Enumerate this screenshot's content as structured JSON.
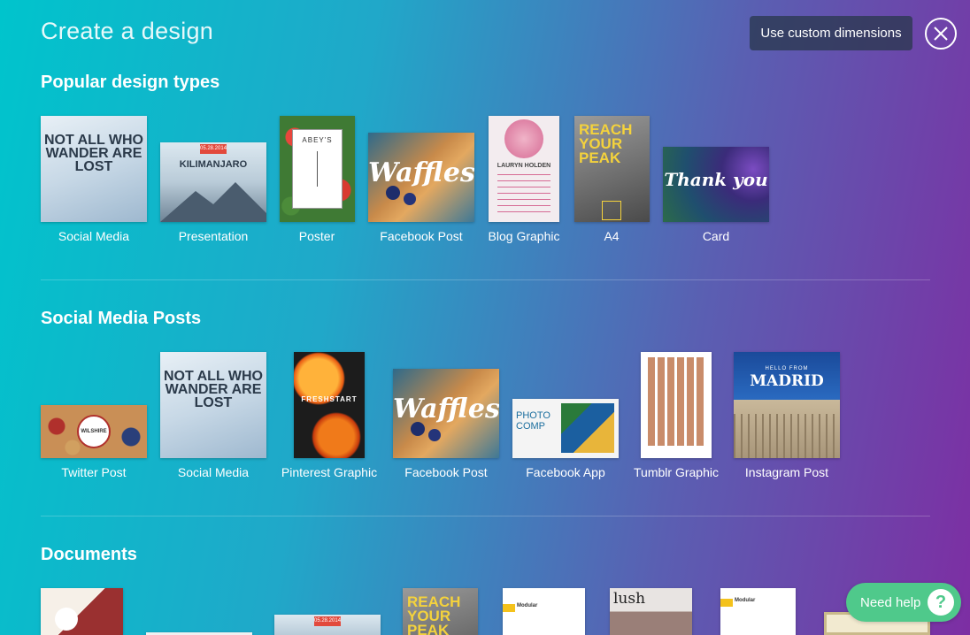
{
  "header": {
    "title": "Create a design",
    "custom_dimensions_label": "Use custom dimensions",
    "close_icon": "close-circle-icon"
  },
  "sections": [
    {
      "title": "Popular design types",
      "items": [
        {
          "label": "Social Media",
          "art": "NOT ALL WHO WANDER ARE LOST"
        },
        {
          "label": "Presentation",
          "art": "KILIMANJARO",
          "badge": "05.28.2014"
        },
        {
          "label": "Poster",
          "art": "ABEY'S"
        },
        {
          "label": "Facebook Post",
          "art": "Waffles"
        },
        {
          "label": "Blog Graphic",
          "art": "LAURYN HOLDEN"
        },
        {
          "label": "A4",
          "art": "REACH YOUR PEAK"
        },
        {
          "label": "Card",
          "art": "Thank you"
        }
      ]
    },
    {
      "title": "Social Media Posts",
      "items": [
        {
          "label": "Twitter Post",
          "art": "WILSHIRE"
        },
        {
          "label": "Social Media",
          "art": "NOT ALL WHO WANDER ARE LOST"
        },
        {
          "label": "Pinterest Graphic",
          "art": "FRESHSTART"
        },
        {
          "label": "Facebook Post",
          "art": "Waffles"
        },
        {
          "label": "Facebook App",
          "art": "PHOTO COMP"
        },
        {
          "label": "Tumblr Graphic",
          "art": ""
        },
        {
          "label": "Instagram Post",
          "art": "MADRID",
          "subart": "HELLO FROM"
        }
      ]
    },
    {
      "title": "Documents",
      "items": [
        {
          "label": "",
          "art": ""
        },
        {
          "label": "",
          "art": ""
        },
        {
          "label": "",
          "art": "",
          "badge": "05.28.2014"
        },
        {
          "label": "",
          "art": "REACH YOUR PEAK"
        },
        {
          "label": "",
          "art": "Modular"
        },
        {
          "label": "",
          "art": "lush"
        },
        {
          "label": "",
          "art": "Modular"
        },
        {
          "label": "",
          "art": ""
        }
      ]
    }
  ],
  "help": {
    "label": "Need help",
    "icon": "question-icon",
    "mark": "?"
  },
  "colors": {
    "gradient_start": "#00c4cc",
    "gradient_end": "#7d2ea3",
    "help_green": "#4fc98b",
    "badge_red": "#e2493c"
  }
}
